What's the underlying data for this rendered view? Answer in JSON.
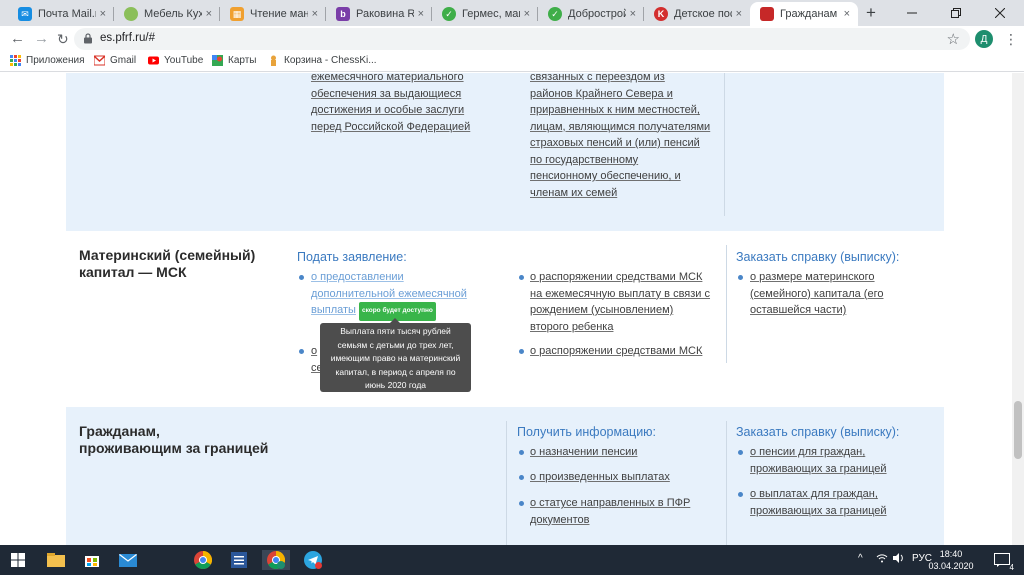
{
  "browser": {
    "tabs": [
      {
        "label": "Почта Mail.ru",
        "color": "#168de2"
      },
      {
        "label": "Мебель Кухон",
        "color": "#8bbf5a"
      },
      {
        "label": "Чтение манги",
        "color": "#f0a030"
      },
      {
        "label": "Раковина Roc",
        "color": "#7a3ea8"
      },
      {
        "label": "Гермес, магаз",
        "color": "#3fae49"
      },
      {
        "label": "Добрострой.р",
        "color": "#3fae49"
      },
      {
        "label": "Детское посо",
        "color": "#d32f2f"
      },
      {
        "label": "Гражданам",
        "color": "#c62828"
      }
    ],
    "close_glyph": "×",
    "new_tab_glyph": "+",
    "address": "es.pfrf.ru/#",
    "profile_initial": "Д",
    "bookmarks": [
      {
        "label": "Приложения",
        "icon": "apps-grid-icon"
      },
      {
        "label": "Gmail",
        "icon": "gmail-icon"
      },
      {
        "label": "YouTube",
        "icon": "youtube-icon"
      },
      {
        "label": "Карты",
        "icon": "maps-icon"
      },
      {
        "label": "Корзина - ChessKi...",
        "icon": "chess-icon"
      }
    ]
  },
  "top_section": {
    "col1_lines": [
      "ежемесячного материального",
      "обеспечения за выдающиеся",
      "достижения и особые заслуги",
      "перед Российской Федерацией"
    ],
    "col2_lines": [
      "связанных с переездом из",
      "районов Крайнего Севера и",
      "приравненных к ним местностей,",
      "лицам, являющимся получателями",
      "страховых пенсий и (или) пенсий",
      "по государственному",
      "пенсионному обеспечению, и",
      "членам их семей"
    ]
  },
  "msk_section": {
    "title_lines": [
      "Материнский (семейный)",
      "капитал — МСК"
    ],
    "apply_heading": "Подать заявление:",
    "item1_lines": [
      "о предоставлении",
      "дополнительной ежемесячной",
      "выплаты"
    ],
    "badge": "скоро будет доступно",
    "item2_partial": [
      "о",
      "се"
    ],
    "item3_lines": [
      "о распоряжении средствами МСК",
      "на ежемесячную выплату в связи с",
      "рождением (усыновлением)",
      "второго ребенка"
    ],
    "item4": "о распоряжении средствами МСК",
    "order_heading": "Заказать справку (выписку):",
    "order_item_lines": [
      "о размере материнского",
      "(семейного) капитала (его",
      "оставшейся части)"
    ],
    "tooltip_lines": [
      "Выплата пяти тысяч рублей",
      "семьям с детьми до трех лет,",
      "имеющим право на материнский",
      "капитал, в период с апреля по",
      "июнь 2020 года"
    ]
  },
  "abroad_section": {
    "title_lines": [
      "Гражданам,",
      "проживающим за границей"
    ],
    "info_heading": "Получить информацию:",
    "info_items": [
      "о назначении пенсии",
      "о произведенных выплатах"
    ],
    "info_item3_lines": [
      "о статусе направленных в ПФР",
      "документов"
    ],
    "order_heading": "Заказать справку (выписку):",
    "order_item1_lines": [
      "о пенсии для граждан,",
      "проживающих за границей"
    ],
    "order_item2_lines": [
      "о выплатах для граждан,",
      "проживающих за границей"
    ]
  },
  "taskbar": {
    "language": "РУС",
    "time": "18:40",
    "date": "03.04.2020",
    "notifications": "4"
  }
}
